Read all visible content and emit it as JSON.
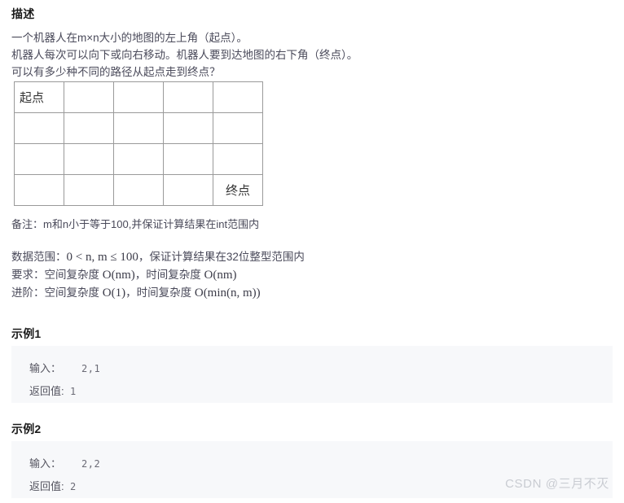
{
  "description": {
    "heading": "描述",
    "lines": [
      "一个机器人在m×n大小的地图的左上角（起点）。",
      "机器人每次可以向下或向右移动。机器人要到达地图的右下角（终点）。",
      "可以有多少种不同的路径从起点走到终点？"
    ]
  },
  "grid": {
    "rows": 4,
    "cols": 5,
    "start_label": "起点",
    "end_label": "终点",
    "border_color": "#9a9a9a"
  },
  "notes": {
    "remark": "备注：m和n小于等于100,并保证计算结果在int范围内",
    "data_range_prefix": "数据范围：",
    "data_range_math": "0 < n, m ≤ 100",
    "data_range_suffix": "，保证计算结果在32位整型范围内",
    "requirement_prefix": "要求：空间复杂度 ",
    "requirement_space": "O(nm)",
    "requirement_mid": "，时间复杂度 ",
    "requirement_time": "O(nm)",
    "advanced_prefix": "进阶：空间复杂度 ",
    "advanced_space": "O(1)",
    "advanced_mid": "，时间复杂度 ",
    "advanced_time": "O(min(n, m))"
  },
  "examples": [
    {
      "title": "示例1",
      "input_label": "输入：",
      "input_value": "2,1",
      "output_label": "返回值:",
      "output_value": "1"
    },
    {
      "title": "示例2",
      "input_label": "输入：",
      "input_value": "2,2",
      "output_label": "返回值:",
      "output_value": "2"
    }
  ],
  "watermark": "CSDN @三月不灭",
  "colors": {
    "page_background": "#ffffff",
    "body_text": "#4a4a5a",
    "heading_text": "#1a1a1a",
    "example_background": "#f7f8fa",
    "watermark_text": "#c9ccd2"
  }
}
